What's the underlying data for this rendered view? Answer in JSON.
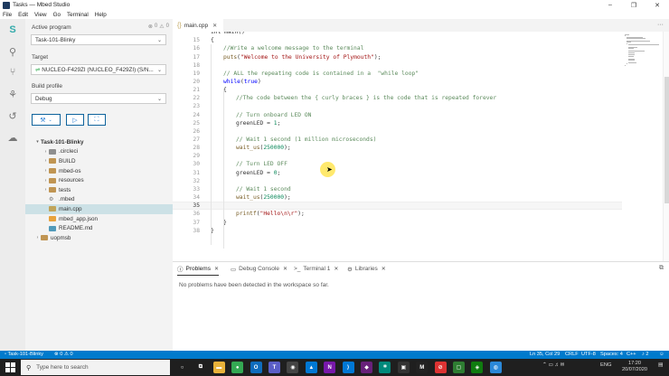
{
  "window": {
    "title": "Tasks — Mbed Studio",
    "controls": [
      "–",
      "❐",
      "✕"
    ]
  },
  "menu": [
    "File",
    "Edit",
    "View",
    "Go",
    "Terminal",
    "Help"
  ],
  "sidebar": {
    "active_program_label": "Active program",
    "active_program_value": "Task-101-Blinky",
    "active_program_counts": [
      "0",
      "0"
    ],
    "target_label": "Target",
    "target_value": "NUCLEO-F429ZI (NUCLEO_F429ZI) (S/N...",
    "build_profile_label": "Build profile",
    "build_profile_value": "Debug",
    "tree": [
      {
        "label": "Task-101-Blinky",
        "depth": 0,
        "kind": "root",
        "twisty": "▾"
      },
      {
        "label": ".circleci",
        "depth": 1,
        "kind": "folder-ci",
        "twisty": "›"
      },
      {
        "label": "BUILD",
        "depth": 1,
        "kind": "folder",
        "twisty": "›"
      },
      {
        "label": "mbed-os",
        "depth": 1,
        "kind": "folder",
        "twisty": "›"
      },
      {
        "label": "resources",
        "depth": 1,
        "kind": "folder",
        "twisty": "›"
      },
      {
        "label": "tests",
        "depth": 1,
        "kind": "folder",
        "twisty": "›"
      },
      {
        "label": ".mbed",
        "depth": 1,
        "kind": "gear",
        "twisty": ""
      },
      {
        "label": "main.cpp",
        "depth": 1,
        "kind": "cpp",
        "twisty": "",
        "selected": true
      },
      {
        "label": "mbed_app.json",
        "depth": 1,
        "kind": "json",
        "twisty": ""
      },
      {
        "label": "README.md",
        "depth": 1,
        "kind": "md",
        "twisty": ""
      },
      {
        "label": "uopmsb",
        "depth": 0,
        "kind": "folder",
        "twisty": "›"
      }
    ]
  },
  "editor": {
    "tab_label": "main.cpp",
    "current_line": 35,
    "lines": [
      {
        "n": "",
        "indent": 0,
        "tokens": [
          [
            "plain",
            "int main()"
          ]
        ]
      },
      {
        "n": "15",
        "indent": 0,
        "tokens": [
          [
            "plain",
            "{"
          ]
        ]
      },
      {
        "n": "16",
        "indent": 1,
        "tokens": [
          [
            "comment",
            "//Write a welcome message to the terminal"
          ]
        ]
      },
      {
        "n": "17",
        "indent": 1,
        "tokens": [
          [
            "func",
            "puts"
          ],
          [
            "plain",
            "("
          ],
          [
            "string",
            "\"Welcome to the University of Plymouth\""
          ],
          [
            "plain",
            ");"
          ]
        ]
      },
      {
        "n": "18",
        "indent": 0,
        "tokens": []
      },
      {
        "n": "19",
        "indent": 1,
        "tokens": [
          [
            "comment",
            "// ALL the repeating code is contained in a  \"while loop\""
          ]
        ]
      },
      {
        "n": "20",
        "indent": 1,
        "tokens": [
          [
            "keyword",
            "while"
          ],
          [
            "plain",
            "("
          ],
          [
            "keyword",
            "true"
          ],
          [
            "plain",
            ")"
          ]
        ]
      },
      {
        "n": "21",
        "indent": 1,
        "tokens": [
          [
            "plain",
            "{"
          ]
        ]
      },
      {
        "n": "22",
        "indent": 2,
        "tokens": [
          [
            "comment",
            "//The code between the { curly braces } is the code that is repeated forever"
          ]
        ]
      },
      {
        "n": "23",
        "indent": 0,
        "tokens": []
      },
      {
        "n": "24",
        "indent": 2,
        "tokens": [
          [
            "comment",
            "// Turn onboard LED ON"
          ]
        ]
      },
      {
        "n": "25",
        "indent": 2,
        "tokens": [
          [
            "plain",
            "greenLED = "
          ],
          [
            "number",
            "1"
          ],
          [
            "plain",
            ";"
          ]
        ]
      },
      {
        "n": "26",
        "indent": 0,
        "tokens": []
      },
      {
        "n": "27",
        "indent": 2,
        "tokens": [
          [
            "comment",
            "// Wait 1 second (1 million microseconds)"
          ]
        ]
      },
      {
        "n": "28",
        "indent": 2,
        "tokens": [
          [
            "func",
            "wait_us"
          ],
          [
            "plain",
            "("
          ],
          [
            "number",
            "250000"
          ],
          [
            "plain",
            ");"
          ]
        ]
      },
      {
        "n": "29",
        "indent": 0,
        "tokens": []
      },
      {
        "n": "30",
        "indent": 2,
        "tokens": [
          [
            "comment",
            "// Turn LED OFF"
          ]
        ]
      },
      {
        "n": "31",
        "indent": 2,
        "tokens": [
          [
            "plain",
            "greenLED = "
          ],
          [
            "number",
            "0"
          ],
          [
            "plain",
            ";"
          ]
        ]
      },
      {
        "n": "32",
        "indent": 0,
        "tokens": []
      },
      {
        "n": "33",
        "indent": 2,
        "tokens": [
          [
            "comment",
            "// Wait 1 second"
          ]
        ]
      },
      {
        "n": "34",
        "indent": 2,
        "tokens": [
          [
            "func",
            "wait_us"
          ],
          [
            "plain",
            "("
          ],
          [
            "number",
            "250000"
          ],
          [
            "plain",
            ");"
          ]
        ]
      },
      {
        "n": "35",
        "indent": 0,
        "tokens": []
      },
      {
        "n": "36",
        "indent": 2,
        "tokens": [
          [
            "func",
            "printf"
          ],
          [
            "plain",
            "("
          ],
          [
            "string",
            "\"Hello\\n\\r\""
          ],
          [
            "plain",
            ");"
          ]
        ]
      },
      {
        "n": "37",
        "indent": 1,
        "tokens": [
          [
            "plain",
            "}"
          ]
        ]
      },
      {
        "n": "38",
        "indent": 0,
        "tokens": [
          [
            "plain",
            "}"
          ]
        ]
      }
    ]
  },
  "panel": {
    "tabs": [
      {
        "label": "Problems",
        "icon": "ⓘ",
        "name": "problems",
        "active": true
      },
      {
        "label": "Debug Console",
        "icon": "▭",
        "name": "debug-console",
        "active": false
      },
      {
        "label": "Terminal 1",
        "icon": ">_",
        "name": "terminal",
        "active": false
      },
      {
        "label": "Libraries",
        "icon": "⚙",
        "name": "libraries",
        "active": false
      }
    ],
    "message": "No problems have been detected in the workspace so far."
  },
  "status": {
    "program": "Task-101-Blinky",
    "problems": "⊗ 0 ⚠ 0",
    "cursor": "Ln 35, Col 29",
    "eol": "CRLF",
    "encoding": "UTF-8",
    "spaces": "Spaces: 4",
    "language": "C++",
    "notifications": "2"
  },
  "taskbar": {
    "search_placeholder": "Type here to search",
    "apps": [
      {
        "name": "cortana",
        "glyph": "○",
        "color": "#1f1f1f"
      },
      {
        "name": "task-view",
        "glyph": "⧉",
        "color": "#1f1f1f"
      },
      {
        "name": "file-explorer",
        "glyph": "▬",
        "color": "#e8b23a"
      },
      {
        "name": "chrome",
        "glyph": "●",
        "color": "#34a853"
      },
      {
        "name": "outlook",
        "glyph": "O",
        "color": "#0f6cbd"
      },
      {
        "name": "teams",
        "glyph": "T",
        "color": "#5b5fc7"
      },
      {
        "name": "github",
        "glyph": "◉",
        "color": "#444"
      },
      {
        "name": "photos",
        "glyph": "▲",
        "color": "#0078d4"
      },
      {
        "name": "onenote",
        "glyph": "N",
        "color": "#7719aa"
      },
      {
        "name": "vscode",
        "glyph": "⟩",
        "color": "#0078d4"
      },
      {
        "name": "visual-studio",
        "glyph": "◆",
        "color": "#68217a"
      },
      {
        "name": "mbed-studio",
        "glyph": "⌗",
        "color": "#00897b"
      },
      {
        "name": "terminal",
        "glyph": "▣",
        "color": "#333"
      },
      {
        "name": "mbed",
        "glyph": "M",
        "color": "#222"
      },
      {
        "name": "record",
        "glyph": "⊘",
        "color": "#d33"
      },
      {
        "name": "camera",
        "glyph": "▢",
        "color": "#2e7d32"
      },
      {
        "name": "xbox",
        "glyph": "◈",
        "color": "#107c10"
      },
      {
        "name": "maps",
        "glyph": "◍",
        "color": "#2b88d8"
      }
    ],
    "tray": "ENG",
    "time": "17:20",
    "date": "20/07/2020"
  },
  "colors": {
    "accent": "#007acc",
    "comment": "#5b8a5b",
    "string": "#a31515",
    "keyword": "#0000ff",
    "number": "#09885a"
  }
}
